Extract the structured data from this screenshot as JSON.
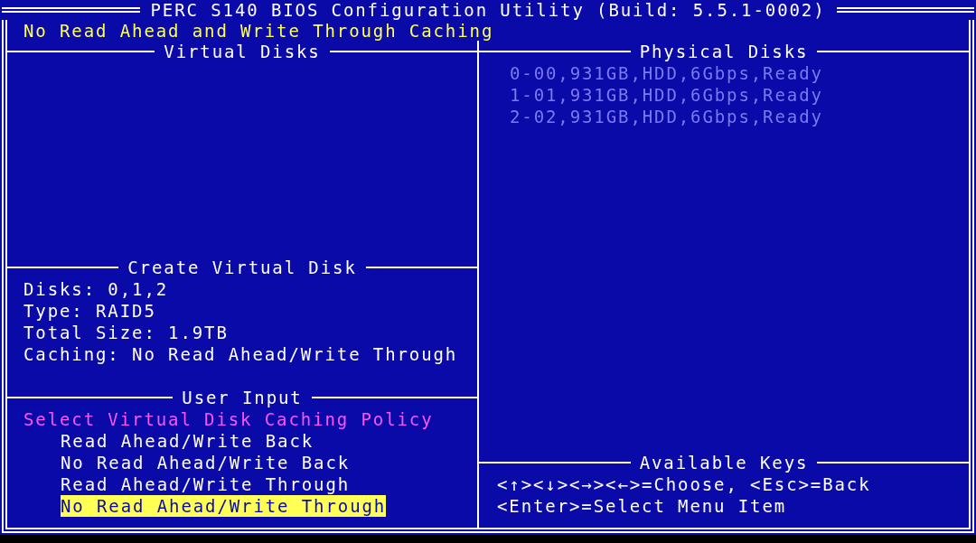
{
  "title": "PERC S140 BIOS Configuration Utility (Build: 5.5.1-0002)",
  "status": "No Read Ahead and Write Through Caching",
  "virtual_disks": {
    "title": "Virtual Disks"
  },
  "physical_disks": {
    "title": "Physical Disks",
    "disks": [
      {
        "label": "0-00,931GB,HDD,6Gbps,Ready",
        "disabled": true
      },
      {
        "label": "1-01,931GB,HDD,6Gbps,Ready",
        "disabled": true
      },
      {
        "label": "2-02,931GB,HDD,6Gbps,Ready",
        "disabled": true
      }
    ]
  },
  "create_virtual_disk": {
    "title": "Create Virtual Disk",
    "lines": [
      "Disks: 0,1,2",
      "Type: RAID5",
      "Total Size: 1.9TB",
      "Caching: No Read Ahead/Write Through"
    ]
  },
  "user_input": {
    "title": "User Input",
    "prompt": "Select Virtual Disk Caching Policy",
    "options": [
      {
        "label": "Read Ahead/Write Back",
        "selected": false
      },
      {
        "label": "No Read Ahead/Write Back",
        "selected": false
      },
      {
        "label": "Read Ahead/Write Through",
        "selected": false
      },
      {
        "label": "No Read Ahead/Write Through",
        "selected": true
      }
    ]
  },
  "available_keys": {
    "title": "Available Keys",
    "lines": [
      "<↑><↓><→><←>=Choose, <Esc>=Back",
      "<Enter>=Select Menu Item"
    ]
  }
}
